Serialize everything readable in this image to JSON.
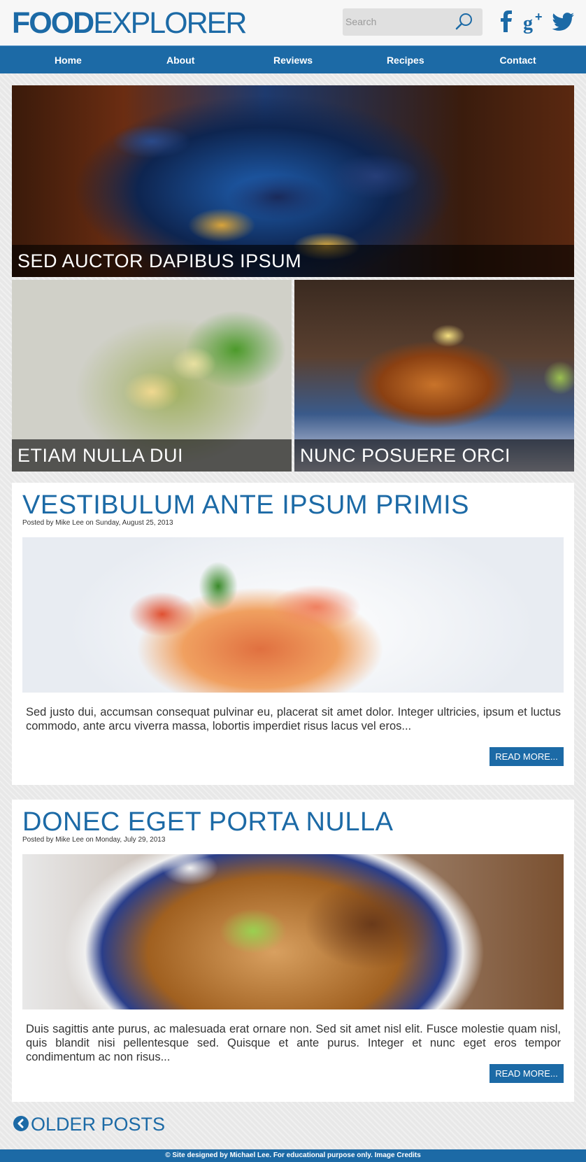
{
  "header": {
    "logo_bold": "FOOD",
    "logo_light": "EXPLORER",
    "search_placeholder": "Search",
    "social": [
      "facebook-icon",
      "google-plus-icon",
      "twitter-icon"
    ]
  },
  "nav": {
    "items": [
      "Home",
      "About",
      "Reviews",
      "Recipes",
      "Contact"
    ]
  },
  "features": [
    {
      "caption": "SED AUCTOR DAPIBUS IPSUM"
    },
    {
      "caption": "ETIAM NULLA DUI"
    },
    {
      "caption": "NUNC POSUERE ORCI"
    }
  ],
  "posts": [
    {
      "title": "VESTIBULUM ANTE IPSUM PRIMIS",
      "meta": "Posted by Mike Lee on Sunday, August 25, 2013",
      "excerpt": "Sed justo dui, accumsan consequat pulvinar eu, placerat sit amet dolor. Integer ultricies, ipsum et luctus commodo, ante arcu viverra massa, lobortis imperdiet risus lacus vel eros...",
      "read_more": "READ MORE..."
    },
    {
      "title": "DONEC EGET PORTA NULLA",
      "meta": "Posted by Mike Lee on Monday, July 29, 2013",
      "excerpt": "Duis sagittis ante purus, ac malesuada erat ornare non. Sed sit amet nisl elit. Fusce molestie quam nisl, quis blandit nisi pellentesque sed. Quisque et ante purus. Integer et nunc eget eros tempor condimentum ac non risus...",
      "read_more": "READ MORE..."
    }
  ],
  "older_posts": "OLDER POSTS",
  "footer": "© Site designed by Michael Lee. For educational purpose only. Image Credits",
  "colors": {
    "accent": "#1c6aa6"
  }
}
